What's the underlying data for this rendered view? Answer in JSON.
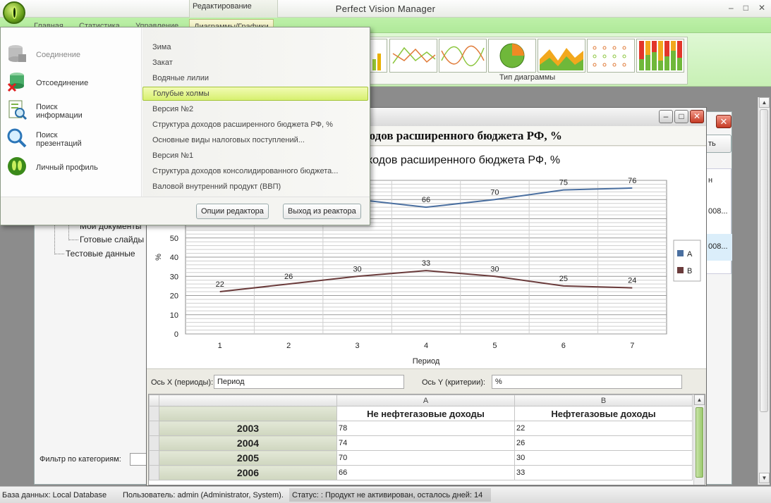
{
  "window": {
    "title": "Perfect Vision Manager",
    "context_tab_group": "Редактирование",
    "min": "–",
    "max": "□",
    "close": "✕"
  },
  "ribbon_tabs": [
    "Главная",
    "Статистика",
    "Управление",
    "Диаграммы/Графики"
  ],
  "ribbon": {
    "chart_type_label": "Тип диаграммы"
  },
  "dropdown": {
    "commands": [
      {
        "label": "Соединение",
        "icon": "database-connect-icon",
        "disabled": true
      },
      {
        "label": "Отсоединение",
        "icon": "database-disconnect-icon",
        "disabled": false
      },
      {
        "label": "Поиск\nинформации",
        "icon": "search-document-icon",
        "disabled": false
      },
      {
        "label": "Поиск\nпрезентаций",
        "icon": "search-magnifier-icon",
        "disabled": false
      },
      {
        "label": "Личный профиль",
        "icon": "user-profile-icon",
        "disabled": false
      }
    ],
    "themes": [
      "Зима",
      "Закат",
      "Водяные лилии",
      "Голубые холмы",
      "Версия №2",
      "Структура доходов расширенного бюджета РФ, %",
      "Основные виды налоговых поступлений...",
      "Версия №1",
      "Структура доходов консолидированного бюджета...",
      "Валовой внутренний продукт (ВВП)"
    ],
    "highlighted_index": 3,
    "editor_options_button": "Опции редактора",
    "exit_editor_button": "Выход из реактора"
  },
  "tree": {
    "items": [
      "Мои документы",
      "Готовые слайды",
      "Тестовые данные"
    ],
    "filter_label": "Фильтр по категориям:"
  },
  "bg_panel": {
    "button_partial": "ть",
    "list_header": "н",
    "list_rows": [
      "008...",
      "008..."
    ]
  },
  "editor": {
    "doc_title": "Структура доходов расширенного бюджета РФ, %",
    "x_axis_label": "Ось X (периоды):",
    "x_axis_value": "Период",
    "y_axis_label": "Ось Y (критерии):",
    "y_axis_value": "%"
  },
  "chart_data": {
    "type": "line",
    "title": "Структура доходов расширенного бюджета РФ, %",
    "xlabel": "Период",
    "ylabel": "%",
    "x": [
      1,
      2,
      3,
      4,
      5,
      6,
      7
    ],
    "ylim": [
      0,
      80
    ],
    "yticks": [
      0,
      10,
      20,
      30,
      40,
      50
    ],
    "legend_position": "right",
    "series": [
      {
        "name": "A",
        "values": [
          78,
          74,
          70,
          66,
          70,
          75,
          76
        ],
        "color": "#4a6fa0"
      },
      {
        "name": "B",
        "values": [
          22,
          26,
          30,
          33,
          30,
          25,
          24
        ],
        "color": "#6a3b3b"
      }
    ]
  },
  "grid": {
    "col_letters": [
      "A",
      "B"
    ],
    "col_headers": [
      "Не нефтегазовые доходы",
      "Нефтегазовые доходы"
    ],
    "rows": [
      {
        "year": "2003",
        "a": "78",
        "b": "22"
      },
      {
        "year": "2004",
        "a": "74",
        "b": "26"
      },
      {
        "year": "2005",
        "a": "70",
        "b": "30"
      },
      {
        "year": "2006",
        "a": "66",
        "b": "33"
      }
    ]
  },
  "status": {
    "db": "База данных: Local Database",
    "user": "Пользователь: admin (Administrator, System).",
    "state": "Статус: : Продукт не активирован, осталось дней: 14"
  }
}
